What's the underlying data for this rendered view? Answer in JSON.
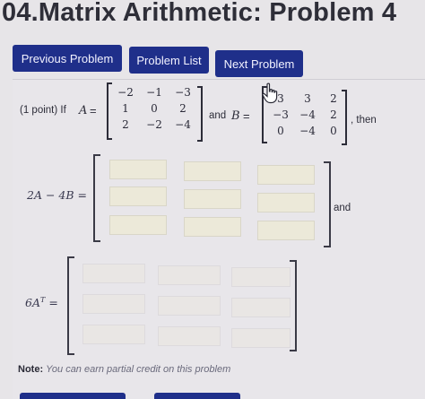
{
  "header": {
    "title": "04.Matrix Arithmetic: Problem 4"
  },
  "nav": {
    "prev_label": "Previous Problem",
    "list_label": "Problem List",
    "next_label": "Next Problem"
  },
  "problem": {
    "points": "(1 point) If",
    "var_a": "A",
    "eq": "=",
    "and_b_text": "and",
    "var_b": "B",
    "then_text": ", then",
    "matrix_a": [
      [
        "−2",
        "−1",
        "−3"
      ],
      [
        "1",
        "0",
        "2"
      ],
      [
        "2",
        "−2",
        "−4"
      ]
    ],
    "matrix_b": [
      [
        "3",
        "3",
        "2"
      ],
      [
        "−3",
        "−4",
        "2"
      ],
      [
        "0",
        "−4",
        "0"
      ]
    ],
    "expr1": "2A − 4B =",
    "and_text": "and",
    "expr2": "6A",
    "expr2_sup": "T",
    "expr2_eq": "="
  },
  "note": {
    "label": "Note:",
    "text": "You can earn partial credit on this problem"
  },
  "colors": {
    "button_bg": "#1f2f8a",
    "input_bg": "#ece9d9",
    "page_bg": "#e7e5e8"
  },
  "icons": [
    "hand-pointer-icon"
  ]
}
